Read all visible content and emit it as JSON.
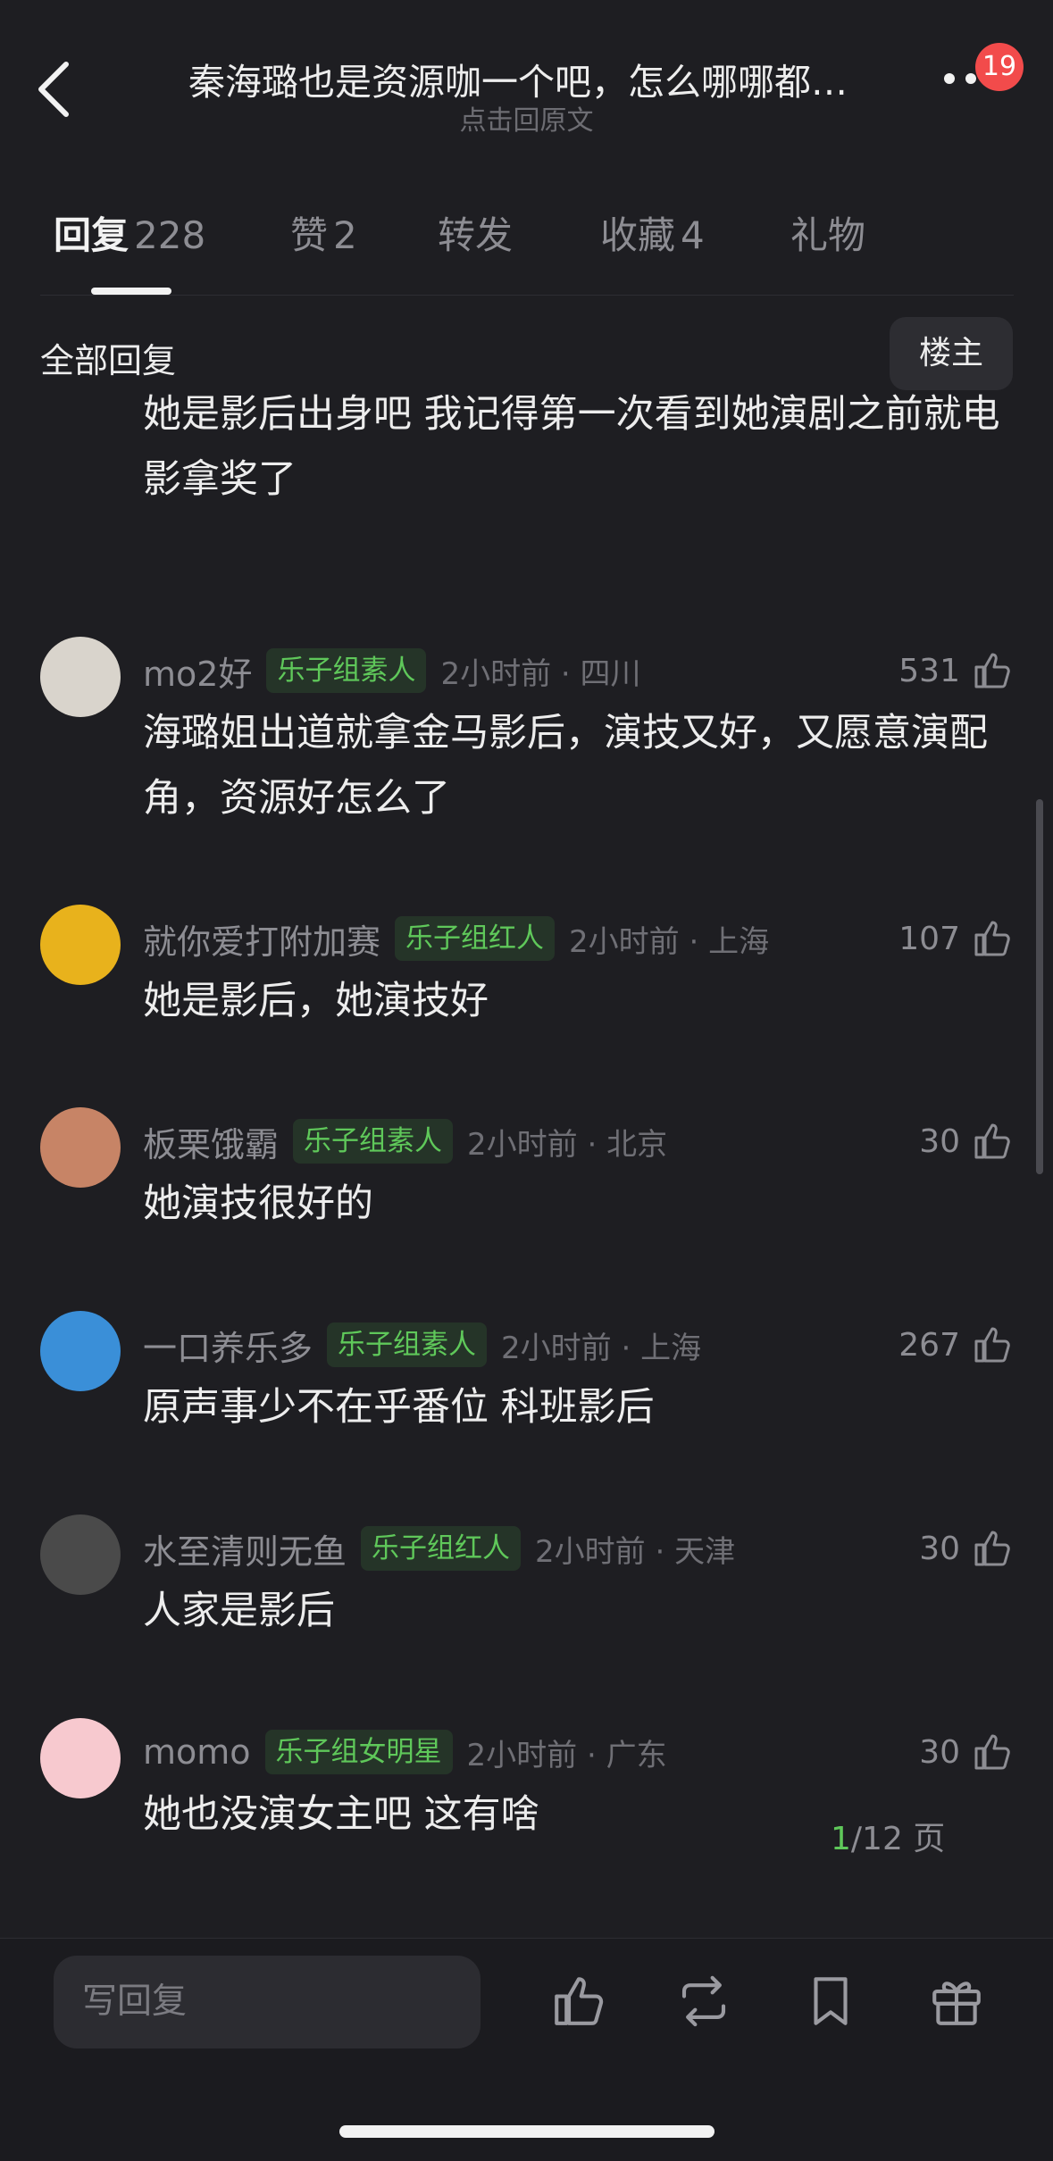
{
  "header": {
    "title": "秦海璐也是资源咖一个吧，怎么哪哪都…",
    "subtitle": "点击回原文",
    "notification_count": "19"
  },
  "tabs": [
    {
      "label": "回复",
      "count": "228"
    },
    {
      "label": "赞",
      "count": "2"
    },
    {
      "label": "转发",
      "count": ""
    },
    {
      "label": "收藏",
      "count": "4"
    },
    {
      "label": "礼物",
      "count": ""
    }
  ],
  "section": {
    "title": "全部回复",
    "owner_button": "楼主"
  },
  "comments": [
    {
      "name": "",
      "tag": "",
      "time": "",
      "likes": "",
      "text": "她是影后出身吧 我记得第一次看到她演剧之前就电影拿奖了",
      "avatar_color": "#6b5a55"
    },
    {
      "name": "mo2好",
      "tag": "乐子组素人",
      "time": "2小时前 · 四川",
      "likes": "531",
      "text": "海璐姐出道就拿金马影后，演技又好，又愿意演配角，资源好怎么了",
      "avatar_color": "#d9d4cc"
    },
    {
      "name": "就你爱打附加赛",
      "tag": "乐子组红人",
      "time": "2小时前 · 上海",
      "likes": "107",
      "text": "她是影后，她演技好",
      "avatar_color": "#e8b21c"
    },
    {
      "name": "板栗饿霸",
      "tag": "乐子组素人",
      "time": "2小时前 · 北京",
      "likes": "30",
      "text": "她演技很好的",
      "avatar_color": "#c78466"
    },
    {
      "name": "一口养乐多",
      "tag": "乐子组素人",
      "time": "2小时前 · 上海",
      "likes": "267",
      "text": "原声事少不在乎番位 科班影后",
      "avatar_color": "#3a8fd8"
    },
    {
      "name": "水至清则无鱼",
      "tag": "乐子组红人",
      "time": "2小时前 · 天津",
      "likes": "30",
      "text": "人家是影后",
      "avatar_color": "#4a4a4a"
    },
    {
      "name": "momo",
      "tag": "乐子组女明星",
      "time": "2小时前 · 广东",
      "likes": "30",
      "text": "她也没演女主吧 这有啥",
      "avatar_color": "#f7c9cf"
    }
  ],
  "pager": {
    "current": "1",
    "total": "/12 页"
  },
  "bottom": {
    "reply_placeholder": "写回复"
  },
  "icons": [
    "back-icon",
    "more-icon",
    "thumbs-up-icon",
    "repost-icon",
    "bookmark-icon",
    "gift-icon"
  ],
  "colors": {
    "background": "#1e1e22",
    "accent_green": "#5fc85a",
    "badge_red": "#f24b4b"
  }
}
